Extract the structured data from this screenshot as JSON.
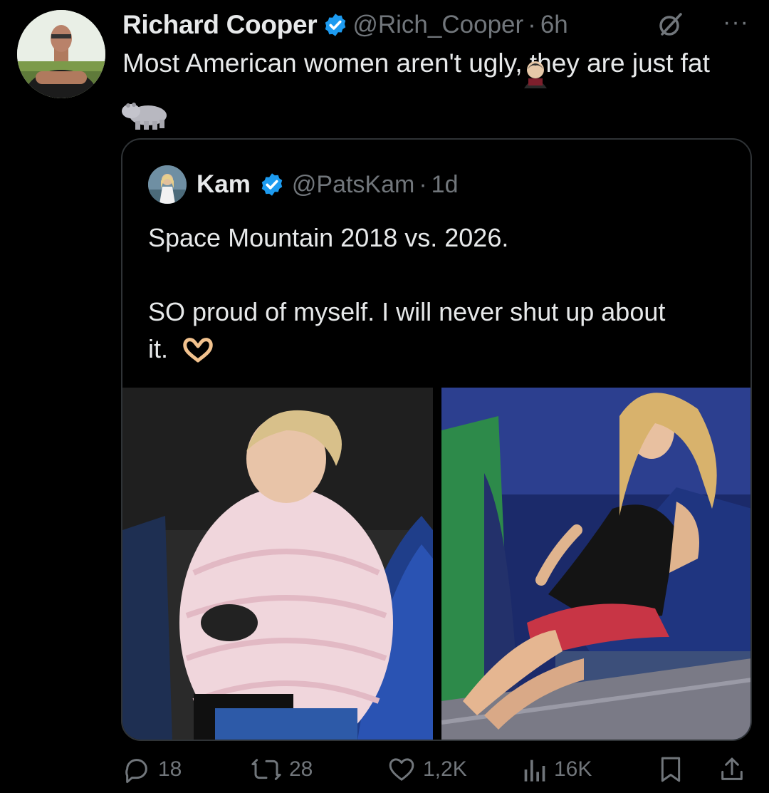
{
  "tweet": {
    "author_name": "Richard Cooper",
    "handle": "@Rich_Cooper",
    "separator": "·",
    "time": "6h",
    "text_part1": "Most American women aren't ugly, they are just fat",
    "emoji_names": [
      "woman-vampire-emoji",
      "hippopotamus-emoji"
    ],
    "more_label": "···"
  },
  "quote": {
    "author_name": "Kam",
    "handle": "@PatsKam",
    "separator": "·",
    "time": "1d",
    "line1": "Space Mountain 2018 vs. 2026.",
    "line2": "SO proud of myself. I will never shut up about it.",
    "emoji_name": "heart-hands-emoji",
    "images": [
      {
        "description_icon": "photo-2018"
      },
      {
        "description_icon": "photo-2026"
      }
    ]
  },
  "actions": {
    "replies": "18",
    "reposts": "28",
    "likes": "1,2K",
    "views": "16K"
  },
  "colors": {
    "background": "#000000",
    "text": "#e7e9ea",
    "muted": "#71767b",
    "verified": "#1d9bf0",
    "border": "#2f3336"
  }
}
